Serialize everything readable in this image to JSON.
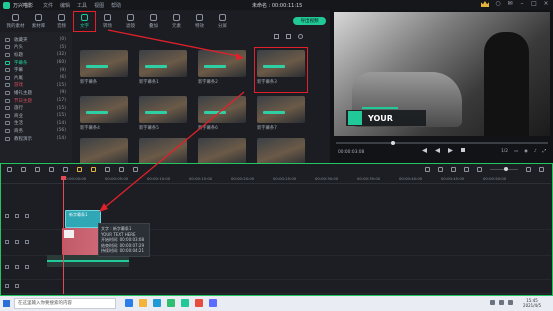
{
  "titlebar": {
    "app": "万兴喵影",
    "menus": [
      "文件",
      "编辑",
      "工具",
      "视图",
      "帮助"
    ],
    "project": "未命名 : 00:00:11:15"
  },
  "tabs": [
    {
      "label": "我的素材"
    },
    {
      "label": "素材库"
    },
    {
      "label": "音频"
    },
    {
      "label": "文字"
    },
    {
      "label": "转场"
    },
    {
      "label": "滤镜"
    },
    {
      "label": "叠加"
    },
    {
      "label": "元素"
    },
    {
      "label": "特效"
    },
    {
      "label": "分屏"
    }
  ],
  "sidebar": [
    {
      "label": "收藏夹",
      "count": "(0)"
    },
    {
      "label": "片头",
      "count": "(5)"
    },
    {
      "label": "标题",
      "count": "(32)"
    },
    {
      "label": "字幕条",
      "count": "(60)"
    },
    {
      "label": "字幕",
      "count": "(9)"
    },
    {
      "label": "片尾",
      "count": "(6)"
    },
    {
      "label": "游戏",
      "count": "(15)"
    },
    {
      "label": "婚礼主题",
      "count": "(9)"
    },
    {
      "label": "节日主题",
      "count": "(17)"
    },
    {
      "label": "旅行",
      "count": "(15)"
    },
    {
      "label": "商业",
      "count": "(15)"
    },
    {
      "label": "生活",
      "count": "(14)"
    },
    {
      "label": "商务",
      "count": "(56)"
    },
    {
      "label": "教程演示",
      "count": "(14)"
    }
  ],
  "cards": [
    "新字幕条",
    "新字幕条1",
    "新字幕条2",
    "新字幕条3",
    "新字幕条4",
    "新字幕条5",
    "新字幕条6",
    "新字幕条7",
    "",
    "",
    "",
    ""
  ],
  "export": {
    "label": "导出视频"
  },
  "preview": {
    "overlay_text": "YOUR",
    "time": "00:00:03:08",
    "ratio": "1/2",
    "progress": 0.27
  },
  "timeline": {
    "ruler": [
      "00:00:00:00",
      "00:00:05:00",
      "00:00:10:00",
      "00:00:15:00",
      "00:00:20:00",
      "00:00:25:00",
      "00:00:30:00",
      "00:00:35:00",
      "00:00:40:00",
      "00:00:45:00",
      "00:00:50:00"
    ],
    "clip_title": "新字幕条1",
    "tooltip": [
      "文字 : 新字幕条1",
      "YOUR TEXT HERE",
      "开始时间: 00:00:03:08",
      "结束时间: 00:00:07:29",
      "持续时间: 00:00:04:21"
    ]
  },
  "taskbar": {
    "search_placeholder": "在这里输入你要搜索的内容",
    "time": "15:45",
    "date": "2021/4/5"
  }
}
